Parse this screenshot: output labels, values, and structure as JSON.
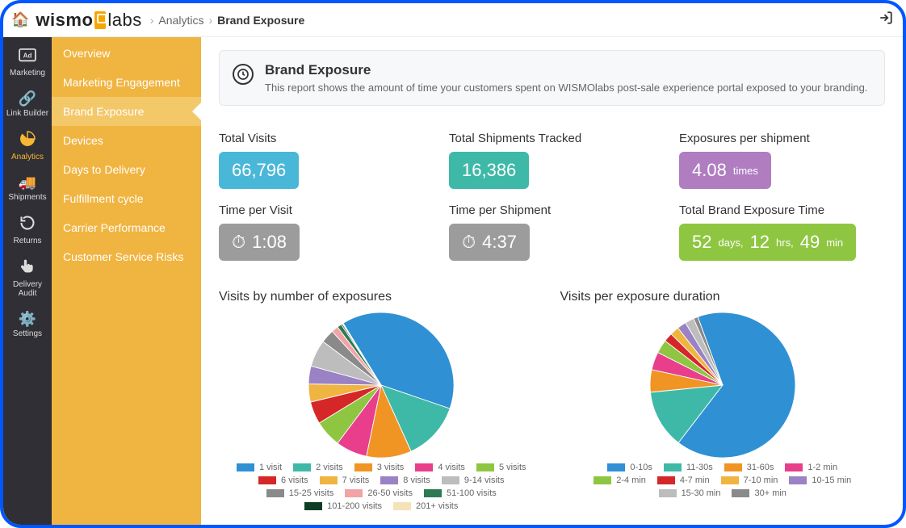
{
  "breadcrumbs": {
    "area": "Analytics",
    "page": "Brand Exposure"
  },
  "rail": {
    "items": [
      {
        "label": "Marketing"
      },
      {
        "label": "Link Builder"
      },
      {
        "label": "Analytics"
      },
      {
        "label": "Shipments"
      },
      {
        "label": "Returns"
      },
      {
        "label": "Delivery Audit"
      },
      {
        "label": "Settings"
      }
    ]
  },
  "subnav": {
    "items": [
      "Overview",
      "Marketing Engagement",
      "Brand Exposure",
      "Devices",
      "Days to Delivery",
      "Fulfillment cycle",
      "Carrier Performance",
      "Customer Service Risks"
    ],
    "selected": "Brand Exposure"
  },
  "banner": {
    "title": "Brand Exposure",
    "desc": "This report shows the amount of time your customers spent on WISMOlabs post-sale experience portal exposed to your branding."
  },
  "metrics": {
    "total_visits": {
      "label": "Total Visits",
      "value": "66,796"
    },
    "total_shipments": {
      "label": "Total Shipments Tracked",
      "value": "16,386"
    },
    "exposures_per_shipment": {
      "label": "Exposures per shipment",
      "value": "4.08",
      "unit": "times"
    },
    "time_per_visit": {
      "label": "Time per Visit",
      "value": "1:08"
    },
    "time_per_shipment": {
      "label": "Time per Shipment",
      "value": "4:37"
    },
    "total_exposure": {
      "label": "Total Brand Exposure Time",
      "days": "52",
      "days_u": "days,",
      "hrs": "12",
      "hrs_u": "hrs,",
      "min": "49",
      "min_u": "min"
    }
  },
  "chart_data": [
    {
      "type": "pie",
      "title": "Visits by number of exposures",
      "series": [
        {
          "name": "1 visit",
          "value": 39,
          "color": "#2f90d4"
        },
        {
          "name": "2 visits",
          "value": 13,
          "color": "#3fb9a7"
        },
        {
          "name": "3 visits",
          "value": 10,
          "color": "#f09424"
        },
        {
          "name": "4 visits",
          "value": 7,
          "color": "#e83e8c"
        },
        {
          "name": "5 visits",
          "value": 6,
          "color": "#8ec641"
        },
        {
          "name": "6 visits",
          "value": 5,
          "color": "#d62728"
        },
        {
          "name": "7 visits",
          "value": 4,
          "color": "#f0b441"
        },
        {
          "name": "8 visits",
          "value": 4,
          "color": "#9b82c4"
        },
        {
          "name": "9-14 visits",
          "value": 6,
          "color": "#bdbdbd"
        },
        {
          "name": "15-25 visits",
          "value": 3,
          "color": "#8a8a8a"
        },
        {
          "name": "26-50 visits",
          "value": 1.5,
          "color": "#f2a3a3"
        },
        {
          "name": "51-100 visits",
          "value": 1,
          "color": "#2d7a52"
        },
        {
          "name": "101-200 visits",
          "value": 0.3,
          "color": "#0e3d24"
        },
        {
          "name": "201+ visits",
          "value": 0.2,
          "color": "#f4e3b8"
        }
      ]
    },
    {
      "type": "pie",
      "title": "Visits per exposure duration",
      "series": [
        {
          "name": "0-10s",
          "value": 66,
          "color": "#2f90d4"
        },
        {
          "name": "11-30s",
          "value": 13,
          "color": "#3fb9a7"
        },
        {
          "name": "31-60s",
          "value": 5,
          "color": "#f09424"
        },
        {
          "name": "1-2 min",
          "value": 4,
          "color": "#e83e8c"
        },
        {
          "name": "2-4 min",
          "value": 3,
          "color": "#8ec641"
        },
        {
          "name": "4-7 min",
          "value": 2,
          "color": "#d62728"
        },
        {
          "name": "7-10 min",
          "value": 2,
          "color": "#f0b441"
        },
        {
          "name": "10-15 min",
          "value": 2,
          "color": "#9b82c4"
        },
        {
          "name": "15-30 min",
          "value": 2,
          "color": "#bdbdbd"
        },
        {
          "name": "30+ min",
          "value": 1,
          "color": "#8a8a8a"
        }
      ]
    }
  ]
}
